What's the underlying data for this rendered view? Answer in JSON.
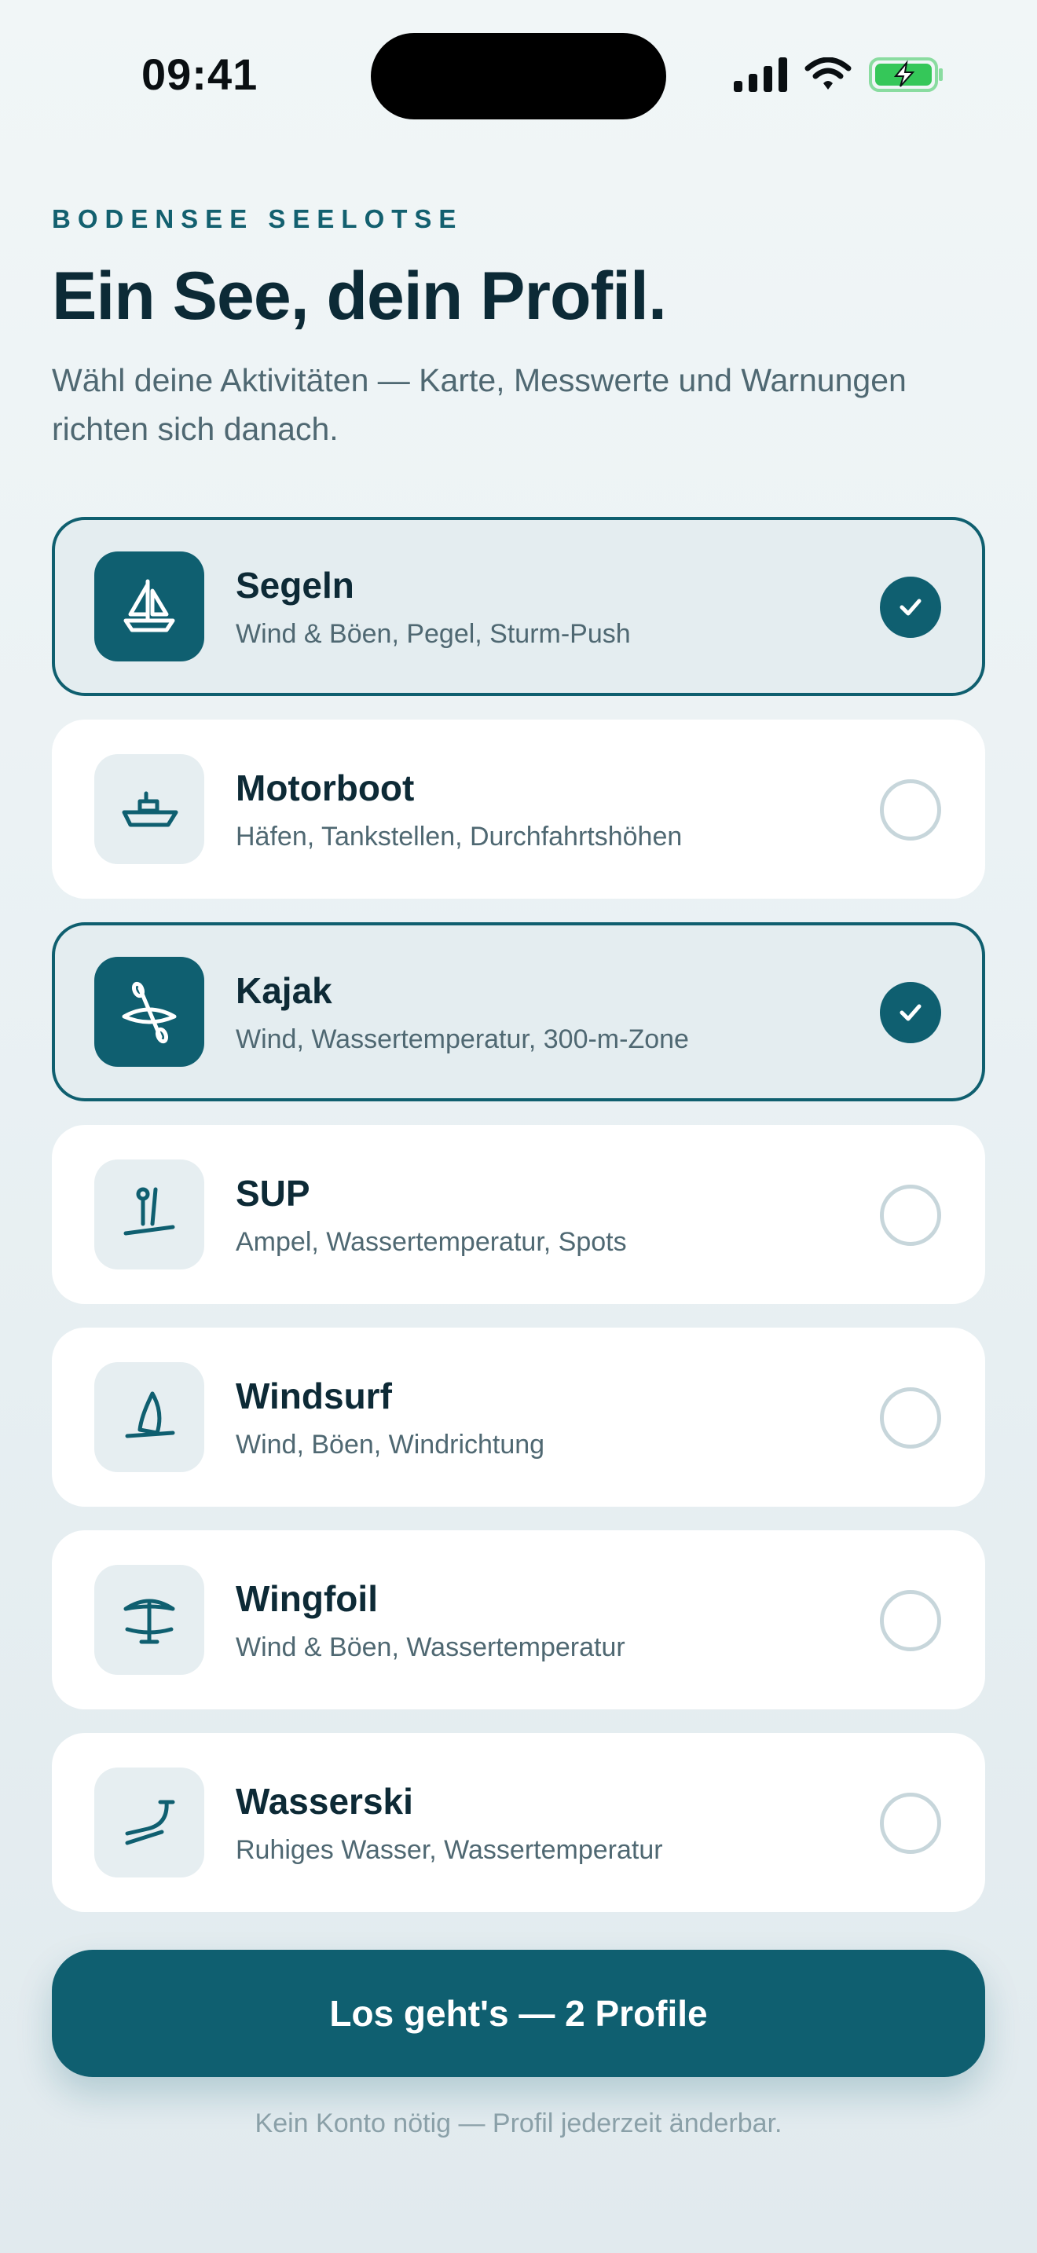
{
  "status_bar": {
    "time": "09:41",
    "icons": [
      "cellular-signal-icon",
      "wifi-icon",
      "battery-charging-icon"
    ],
    "battery_color": "#35c759"
  },
  "header": {
    "eyebrow": "BODENSEE SEELOTSE",
    "title": "Ein See, dein Profil.",
    "subtitle": "Wähl deine Aktivitäten — Karte, Messwerte und Warnungen richten sich danach."
  },
  "activities": [
    {
      "label": "Segeln",
      "desc": "Wind & Böen, Pegel, Sturm-Push",
      "icon": "sailboat-icon",
      "selected": true
    },
    {
      "label": "Motorboot",
      "desc": "Häfen, Tankstellen, Durchfahrtshöhen",
      "icon": "motorboat-icon",
      "selected": false
    },
    {
      "label": "Kajak",
      "desc": "Wind, Wassertemperatur, 300-m-Zone",
      "icon": "kayak-icon",
      "selected": true
    },
    {
      "label": "SUP",
      "desc": "Ampel, Wassertemperatur, Spots",
      "icon": "sup-icon",
      "selected": false
    },
    {
      "label": "Windsurf",
      "desc": "Wind, Böen, Windrichtung",
      "icon": "windsurf-icon",
      "selected": false
    },
    {
      "label": "Wingfoil",
      "desc": "Wind & Böen, Wassertemperatur",
      "icon": "wingfoil-icon",
      "selected": false
    },
    {
      "label": "Wasserski",
      "desc": "Ruhiges Wasser, Wassertemperatur",
      "icon": "waterski-icon",
      "selected": false
    }
  ],
  "cta": {
    "label": "Los geht's — 2 Profile"
  },
  "footnote": "Kein Konto nötig — Profil jederzeit änderbar.",
  "colors": {
    "accent": "#0f5f70",
    "eyebrow": "#13606f",
    "selected_card_bg": "#e4edf0",
    "card_bg": "#ffffff",
    "icon_tile_bg": "#e6eef1",
    "text_primary": "#0d2a36",
    "text_secondary": "#4f6872"
  }
}
